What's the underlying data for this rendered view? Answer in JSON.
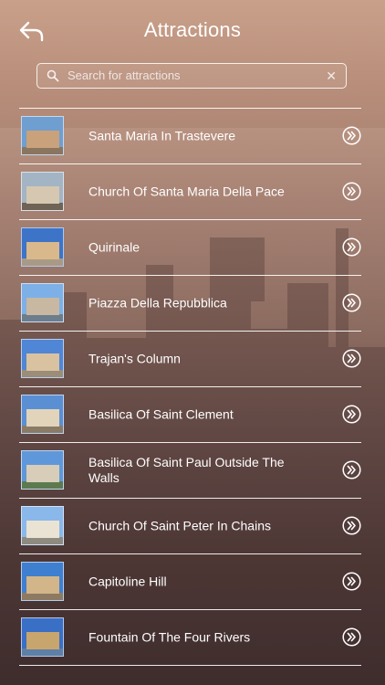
{
  "header": {
    "title": "Attractions",
    "back_icon": "back-arrow-icon"
  },
  "search": {
    "placeholder": "Search for attractions",
    "value": "",
    "search_icon": "search-icon",
    "clear_icon": "clear-icon"
  },
  "attractions": [
    {
      "label": "Santa Maria In Trastevere",
      "thumb_colors": [
        "#6f9ed0",
        "#c9a17a",
        "#8a7560"
      ]
    },
    {
      "label": "Church Of Santa Maria Della Pace",
      "thumb_colors": [
        "#a3b4c4",
        "#d6c8b0",
        "#6e6356"
      ]
    },
    {
      "label": "Quirinale",
      "thumb_colors": [
        "#3d74c8",
        "#d9b98b",
        "#a89a86"
      ]
    },
    {
      "label": "Piazza Della Repubblica",
      "thumb_colors": [
        "#7db0e6",
        "#c8b8a2",
        "#6c7d8c"
      ]
    },
    {
      "label": "Trajan's Column",
      "thumb_colors": [
        "#4f86d6",
        "#d8c2a0",
        "#9b8d78"
      ]
    },
    {
      "label": "Basilica Of Saint Clement",
      "thumb_colors": [
        "#5a8fd4",
        "#e2d4bb",
        "#8a7b66"
      ]
    },
    {
      "label": "Basilica Of Saint Paul Outside The Walls",
      "thumb_colors": [
        "#5f98da",
        "#d8cdb8",
        "#5c7a4e"
      ]
    },
    {
      "label": "Church Of Saint Peter In Chains",
      "thumb_colors": [
        "#8ab8ea",
        "#eae3d4",
        "#8d8a80"
      ]
    },
    {
      "label": "Capitoline Hill",
      "thumb_colors": [
        "#3f7fd0",
        "#d3b58a",
        "#8e7a62"
      ]
    },
    {
      "label": "Fountain Of The Four Rivers",
      "thumb_colors": [
        "#3a6fc6",
        "#c9a56e",
        "#5e7fa6"
      ]
    }
  ],
  "item_action_icon": "double-chevron-right-icon"
}
